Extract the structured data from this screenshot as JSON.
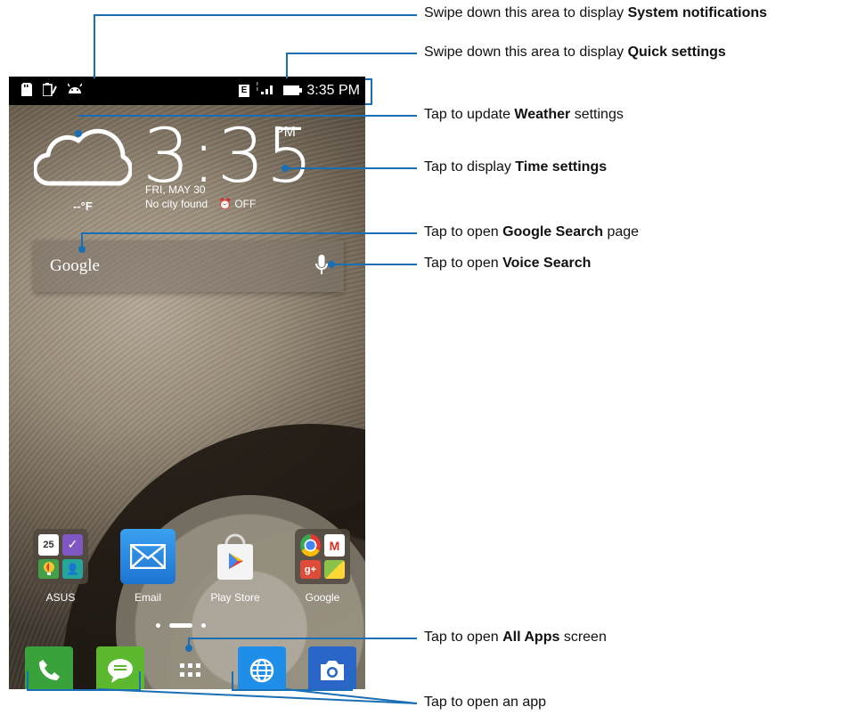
{
  "statusbar": {
    "time": "3:35 PM",
    "network_badge": "E"
  },
  "weather": {
    "temp": "--°F"
  },
  "clock": {
    "time": "3:35",
    "ampm": "PM",
    "date": "FRI, MAY 30",
    "city": "No city found",
    "alarm": "OFF"
  },
  "search": {
    "logo": "Google"
  },
  "apps": [
    {
      "label": "ASUS",
      "icon": "asus-folder-icon"
    },
    {
      "label": "Email",
      "icon": "email-icon"
    },
    {
      "label": "Play Store",
      "icon": "play-store-icon"
    },
    {
      "label": "Google",
      "icon": "google-folder-icon"
    }
  ],
  "folder_asus": {
    "calendar_day": "25"
  },
  "dock": [
    {
      "icon": "phone-icon",
      "color": "#3aa23a"
    },
    {
      "icon": "messaging-icon",
      "color": "#5cb82e"
    },
    {
      "icon": "all-apps-icon",
      "color": "#ffffff"
    },
    {
      "icon": "browser-icon",
      "color": "#1e8ee8"
    },
    {
      "icon": "camera-icon",
      "color": "#2a66c8"
    }
  ],
  "annotations": [
    {
      "pre": "Swipe down this area to display ",
      "bold": "System notifications",
      "post": ""
    },
    {
      "pre": "Swipe down this area to display ",
      "bold": "Quick settings",
      "post": ""
    },
    {
      "pre": "Tap to update ",
      "bold": "Weather",
      "post": " settings"
    },
    {
      "pre": "Tap to display ",
      "bold": "Time settings",
      "post": ""
    },
    {
      "pre": "Tap to open ",
      "bold": "Google Search",
      "post": " page"
    },
    {
      "pre": "Tap to open ",
      "bold": "Voice Search",
      "post": ""
    },
    {
      "pre": "Tap to open ",
      "bold": "All Apps",
      "post": " screen"
    },
    {
      "pre": "Tap to open an app",
      "bold": "",
      "post": ""
    }
  ]
}
